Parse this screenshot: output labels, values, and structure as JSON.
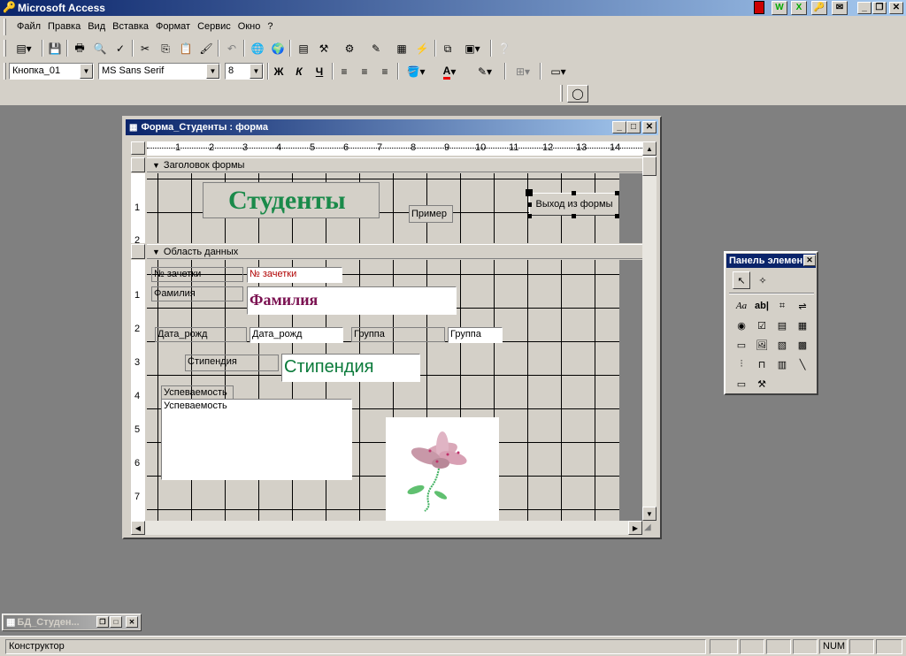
{
  "app": {
    "title": "Microsoft Access",
    "window_buttons": {
      "minimize": "_",
      "restore": "❐",
      "close": "✕"
    }
  },
  "menu": {
    "items": [
      "Файл",
      "Правка",
      "Вид",
      "Вставка",
      "Формат",
      "Сервис",
      "Окно",
      "?"
    ]
  },
  "format_toolbar": {
    "object": "Кнопка_01",
    "font": "MS Sans Serif",
    "size": "8",
    "bold": "Ж",
    "italic": "К",
    "underline": "Ч",
    "font_color_glyph": "A"
  },
  "form_window": {
    "title": "Форма_Студенты : форма",
    "ruler_numbers": [
      "1",
      "2",
      "3",
      "4",
      "5",
      "6",
      "7",
      "8",
      "9",
      "10",
      "11",
      "12",
      "13",
      "14"
    ],
    "vruler_header": [
      "1",
      "2"
    ],
    "vruler_detail": [
      "1",
      "2",
      "3",
      "4",
      "5",
      "6",
      "7"
    ],
    "header_section": "Заголовок формы",
    "detail_section": "Область данных",
    "header_controls": {
      "title_label": "Студенты",
      "example_label": "Пример",
      "exit_button": "Выход из формы"
    },
    "detail_controls": {
      "zachetka_label": "№ зачетки",
      "zachetka_field": "№ зачетки",
      "familia_label": "Фамилия",
      "familia_field": "Фамилия",
      "datarozh_label": "Дата_рожд",
      "datarozh_field": "Дата_рожд",
      "gruppa_label": "Группа",
      "gruppa_field": "Группа",
      "stipendia_label": "Стипендия",
      "stipendia_field": "Стипендия",
      "uspevaemost_label": "Успеваемость",
      "uspevaemost_field": "Успеваемость"
    }
  },
  "toolbox": {
    "title": "Панель элемен"
  },
  "minimized_window": {
    "title": "БД_Студен..."
  },
  "status": {
    "mode": "Конструктор",
    "num": "NUM"
  },
  "colors": {
    "titlebar": "#0a246a",
    "students_title": "#1a8a4a",
    "familia": "#7a1050",
    "stipendia": "#0a7a3a",
    "zachetka_red": "#b00000"
  }
}
